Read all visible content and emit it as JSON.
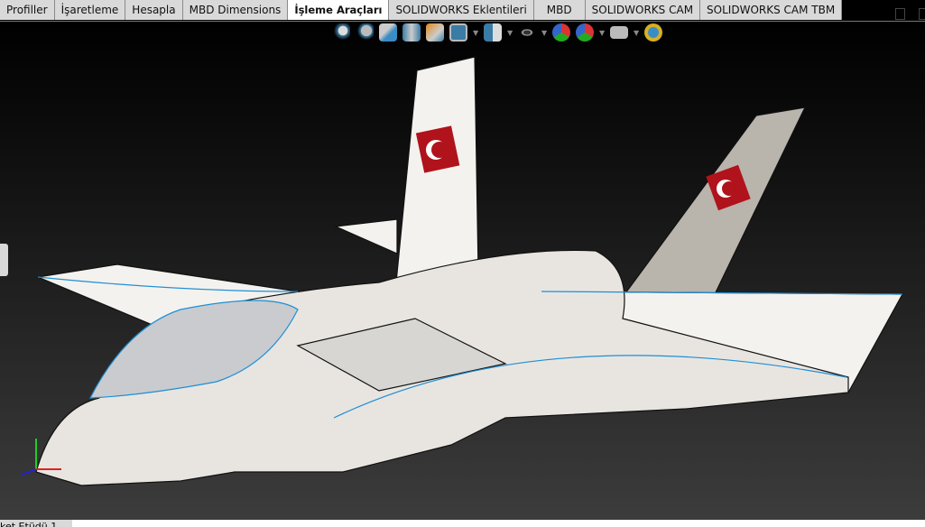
{
  "tabs": [
    {
      "label": "Profiller",
      "active": false
    },
    {
      "label": "İşaretleme",
      "active": false
    },
    {
      "label": "Hesapla",
      "active": false
    },
    {
      "label": "MBD Dimensions",
      "active": false
    },
    {
      "label": "İşleme Araçları",
      "active": true
    },
    {
      "label": "SOLIDWORKS Eklentileri",
      "active": false
    },
    {
      "label": "MBD",
      "active": false
    },
    {
      "label": "SOLIDWORKS CAM",
      "active": false
    },
    {
      "label": "SOLIDWORKS CAM TBM",
      "active": false
    }
  ],
  "view_toolbar": [
    "zoom-to-fit-icon",
    "zoom-to-area-icon",
    "previous-view-icon",
    "section-view-icon",
    "dynamic-annotation-icon",
    "view-orientation-icon",
    "display-style-icon",
    "hide-show-items-icon",
    "edit-appearance-icon",
    "apply-scene-icon",
    "view-settings-icon",
    "measure-icon"
  ],
  "bottom_tab": {
    "label": "ket Etüdü 1"
  },
  "colors": {
    "accent_edge": "#1f8fd6",
    "flag_red": "#b0131b"
  }
}
